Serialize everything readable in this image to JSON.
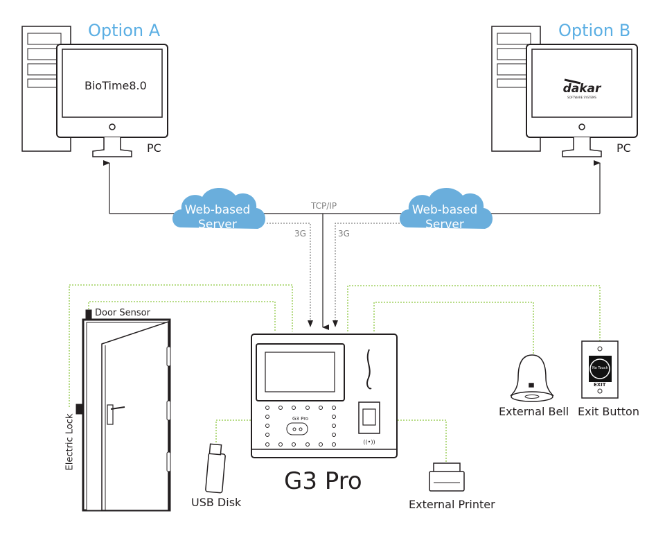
{
  "option_a": {
    "title": "Option A",
    "screen_text": "BioTime8.0",
    "pc_label": "PC"
  },
  "option_b": {
    "title": "Option B",
    "screen_logo": "dakar",
    "screen_logo_sub": "SOFTWARE SYSTEMS",
    "pc_label": "PC"
  },
  "network": {
    "left_cloud": [
      "Web-based",
      "Server"
    ],
    "right_cloud": [
      "Web-based",
      "Server"
    ],
    "tcp_label": "TCP/IP",
    "left_3g": "3G",
    "right_3g": "3G"
  },
  "device": {
    "name": "G3 Pro",
    "panel_label": "G3 Pro"
  },
  "peripherals": {
    "door_sensor": "Door Sensor",
    "electric_lock": "Electric Lock",
    "usb_disk": "USB Disk",
    "external_printer": "External Printer",
    "external_bell": "External Bell",
    "exit_button": "Exit Button",
    "exit_button_face": "No Touch",
    "exit_button_text": "EXIT"
  },
  "colors": {
    "cloud": "#6aaedc",
    "option_title": "#5aaee3",
    "wire_green": "#8cc63f",
    "wire_gray": "#808080"
  }
}
